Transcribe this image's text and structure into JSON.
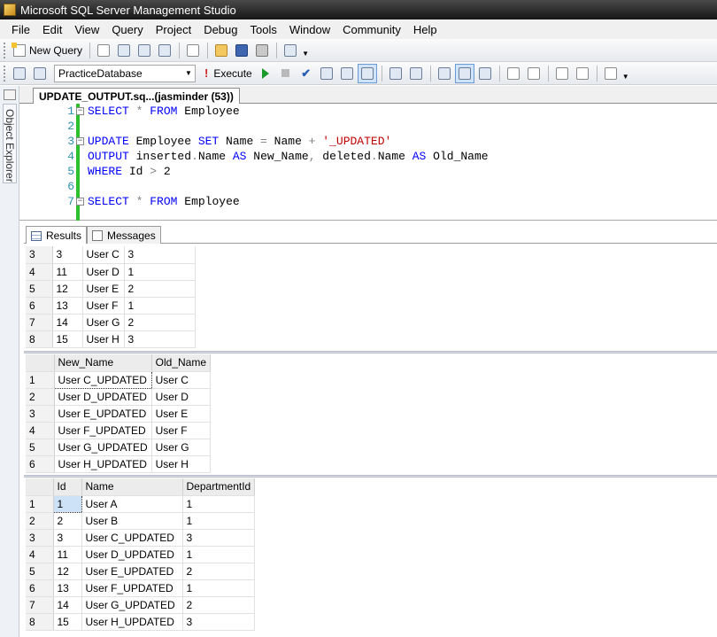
{
  "window": {
    "title": "Microsoft SQL Server Management Studio"
  },
  "menu": [
    "File",
    "Edit",
    "View",
    "Query",
    "Project",
    "Debug",
    "Tools",
    "Window",
    "Community",
    "Help"
  ],
  "toolbar": {
    "new_query_label": "New Query",
    "database": "PracticeDatabase",
    "execute_label": "Execute"
  },
  "side_panel": {
    "label": "Object Explorer"
  },
  "document_tab": {
    "label": "UPDATE_OUTPUT.sq...(jasminder (53))"
  },
  "editor": {
    "line_numbers": [
      "1",
      "2",
      "3",
      "4",
      "5",
      "6",
      "7"
    ],
    "lines": [
      "SELECT * FROM Employee",
      "",
      "UPDATE Employee SET Name = Name + '_UPDATED'",
      "OUTPUT inserted.Name AS New_Name, deleted.Name AS Old_Name",
      "WHERE Id > 2",
      "",
      "SELECT * FROM Employee"
    ]
  },
  "result_tabs": {
    "results": "Results",
    "messages": "Messages"
  },
  "grid1": {
    "rows": [
      [
        "3",
        "3",
        "User C",
        "3"
      ],
      [
        "4",
        "11",
        "User D",
        "1"
      ],
      [
        "5",
        "12",
        "User E",
        "2"
      ],
      [
        "6",
        "13",
        "User F",
        "1"
      ],
      [
        "7",
        "14",
        "User G",
        "2"
      ],
      [
        "8",
        "15",
        "User H",
        "3"
      ]
    ]
  },
  "grid2": {
    "headers": [
      "New_Name",
      "Old_Name"
    ],
    "rows": [
      [
        "1",
        "User C_UPDATED",
        "User C"
      ],
      [
        "2",
        "User D_UPDATED",
        "User D"
      ],
      [
        "3",
        "User E_UPDATED",
        "User E"
      ],
      [
        "4",
        "User F_UPDATED",
        "User F"
      ],
      [
        "5",
        "User G_UPDATED",
        "User G"
      ],
      [
        "6",
        "User H_UPDATED",
        "User H"
      ]
    ]
  },
  "grid3": {
    "headers": [
      "Id",
      "Name",
      "DepartmentId"
    ],
    "rows": [
      [
        "1",
        "1",
        "User A",
        "1"
      ],
      [
        "2",
        "2",
        "User B",
        "1"
      ],
      [
        "3",
        "3",
        "User C_UPDATED",
        "3"
      ],
      [
        "4",
        "11",
        "User D_UPDATED",
        "1"
      ],
      [
        "5",
        "12",
        "User E_UPDATED",
        "2"
      ],
      [
        "6",
        "13",
        "User F_UPDATED",
        "1"
      ],
      [
        "7",
        "14",
        "User G_UPDATED",
        "2"
      ],
      [
        "8",
        "15",
        "User H_UPDATED",
        "3"
      ]
    ]
  }
}
